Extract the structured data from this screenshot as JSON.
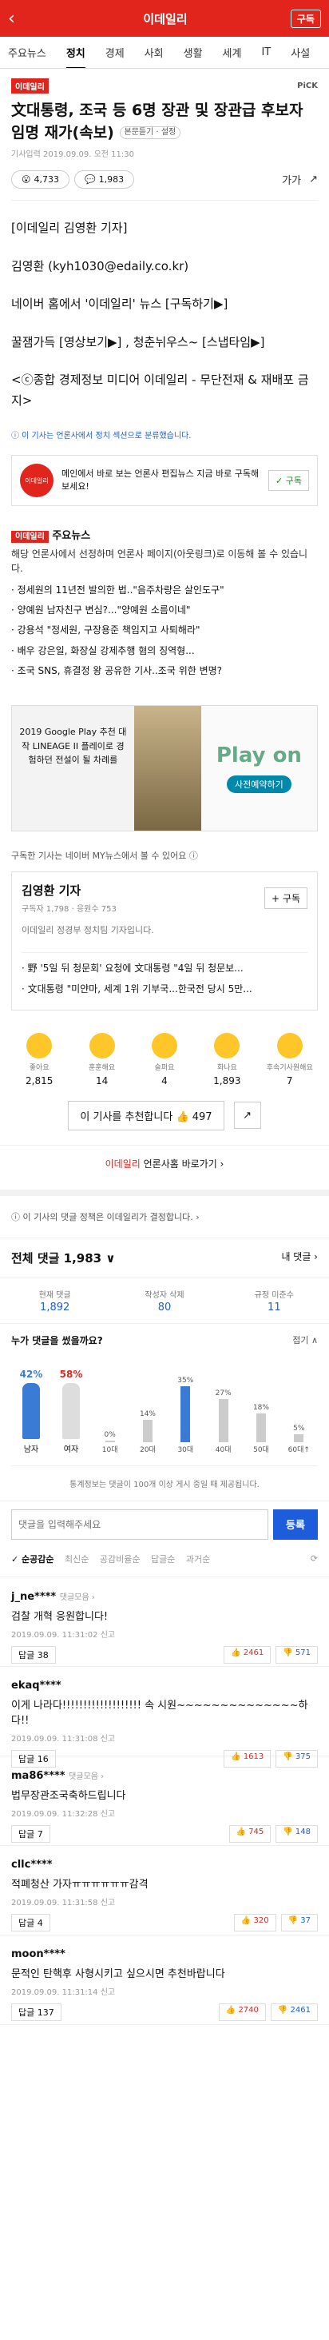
{
  "header": {
    "back": "‹",
    "title": "이데일리",
    "subscribe": "구독"
  },
  "tabs": [
    "주요뉴스",
    "정치",
    "경제",
    "사회",
    "생활",
    "세계",
    "IT",
    "사설"
  ],
  "article": {
    "press_badge": "이데일리",
    "pick": "PiCK",
    "headline": "文대통령, 조국 등 6명 장관 및 장관급 후보자 임명 재가(속보)",
    "chip": "본문듣기 · 설정",
    "meta": "기사입력 2019.09.09. 오전 11:30",
    "reactions": "4,733",
    "comments": "1,983",
    "font_icon": "가가",
    "share_icon": "↗",
    "p1": "[이데일리 김영환 기자]",
    "p2": "김영환 (kyh1030@edaily.co.kr)",
    "p3": "네이버 홈에서 '이데일리' 뉴스 [구독하기▶]",
    "p4": "꿀잼가득 [영상보기▶] , 청춘뉘우스~ [스냅타임▶]",
    "p5": "<ⓒ종합 경제정보 미디어 이데일리 - 무단전재 & 재배포 금지>",
    "notice": "ⓘ 이 기사는 언론사에서 정치 섹션으로 분류했습니다."
  },
  "subscribe_box": {
    "logo": "이데일리",
    "text": "메인에서 바로 보는 언론사 편집뉴스 지금 바로 구독해보세요!",
    "btn": "✓ 구독"
  },
  "main_news": {
    "header_badge": "이데일리",
    "header": "주요뉴스",
    "desc": "해당 언론사에서 선정하며 언론사 페이지(아웃링크)로 이동해 볼 수 있습니다.",
    "items": [
      "정세원의 11년전 발의한 법..\"음주차량은 살인도구\"",
      "양예원 남자친구 변심?...\"양예원 소름이네\"",
      "강용석 \"정세원, 구장용준 책임지고 사퇴해라\"",
      "배우 강은일, 화장실 강제추행 혐의 징역형...",
      "조국 SNS, 휴결정 왕 공유한 기사..조국 위한 변명?"
    ]
  },
  "ad": {
    "left": "2019 Google Play 추천 대작 LINEAGE II 플레이로 경험하던 전설이 될 차례를",
    "brand": "Play on",
    "go": "사전예약하기"
  },
  "mynews_note": "구독한 기사는 네이버 MY뉴스에서 볼 수 있어요 ⓘ",
  "reporter": {
    "name": "김영환 기자",
    "stats": "구독자 1,798 · 응원수 753",
    "follow": "+ 구독",
    "intro": "이데일리 정경부 정치팀 기자입니다.",
    "items": [
      "野 '5일 뒤 청문회' 요청에 文대통령 \"4일 뒤 청문보...",
      "文대통령 \"미얀마, 세계 1위 기부국...한국전 당시 5만..."
    ]
  },
  "emotions": [
    {
      "label": "좋아요",
      "count": "2,815"
    },
    {
      "label": "훈훈해요",
      "count": "14"
    },
    {
      "label": "슬퍼요",
      "count": "4"
    },
    {
      "label": "화나요",
      "count": "1,893"
    },
    {
      "label": "후속기사원해요",
      "count": "7"
    }
  ],
  "recommend": "이 기사를 추천합니다 👍 497",
  "press_link": {
    "red": "이데일리",
    "rest": " 언론사홈 바로가기 ›"
  },
  "policy": "ⓘ 이 기사의 댓글 정책은 이데일리가 결정합니다. ›",
  "comments_head": {
    "title": "전체 댓글 1,983 ∨",
    "my": "내 댓글 ›"
  },
  "stat3": [
    {
      "label": "현재 댓글",
      "value": "1,892"
    },
    {
      "label": "작성자 삭제",
      "value": "80"
    },
    {
      "label": "규정 미준수",
      "value": "11"
    }
  ],
  "who": {
    "title": "누가 댓글을 썼을까요?",
    "fold": "접기 ∧",
    "male": "42%",
    "male_label": "남자",
    "female": "58%",
    "female_label": "여자",
    "ages": [
      {
        "label": "10대",
        "pct": "0%",
        "v": 0
      },
      {
        "label": "20대",
        "pct": "14%",
        "v": 14
      },
      {
        "label": "30대",
        "pct": "35%",
        "v": 35
      },
      {
        "label": "40대",
        "pct": "27%",
        "v": 27
      },
      {
        "label": "50대",
        "pct": "18%",
        "v": 18
      },
      {
        "label": "60대↑",
        "pct": "5%",
        "v": 5
      }
    ],
    "note": "통계정보는 댓글이 100개 이상 게시 중일 때 제공됩니다."
  },
  "input": {
    "placeholder": "댓글을 입력해주세요",
    "post": "등록"
  },
  "sort": [
    "✓ 순공감순",
    "최신순",
    "공감비율순",
    "답글순",
    "과거순"
  ],
  "list": [
    {
      "user": "j_ne****",
      "tag": "댓글모음 ›",
      "text": "검찰 개혁 응원합니다!",
      "date": "2019.09.09. 11:31:02 신고",
      "reply": "답글 38",
      "up": "2461",
      "down": "571"
    },
    {
      "user": "ekaq****",
      "tag": "",
      "text": "이게 나라다!!!!!!!!!!!!!!!!!!! 속 시원~~~~~~~~~~~~~~하다!!",
      "date": "2019.09.09. 11:31:08 신고",
      "reply": "답글 16",
      "up": "1613",
      "down": "375"
    },
    {
      "user": "ma86****",
      "tag": "댓글모음 ›",
      "text": "법무장관조국축하드립니다",
      "date": "2019.09.09. 11:32:28 신고",
      "reply": "답글 7",
      "up": "745",
      "down": "148"
    },
    {
      "user": "cllc****",
      "tag": "",
      "text": "적폐청산 가자ㅠㅠㅠㅠㅠㅠ감격",
      "date": "2019.09.09. 11:31:58 신고",
      "reply": "답글 4",
      "up": "320",
      "down": "37"
    },
    {
      "user": "moon****",
      "tag": "",
      "text": "문적인 탄핵후 사형시키고 싶으시면 추천바랍니다",
      "date": "2019.09.09. 11:31:14 신고",
      "reply": "답글 137",
      "up": "2740",
      "down": "2461"
    }
  ]
}
